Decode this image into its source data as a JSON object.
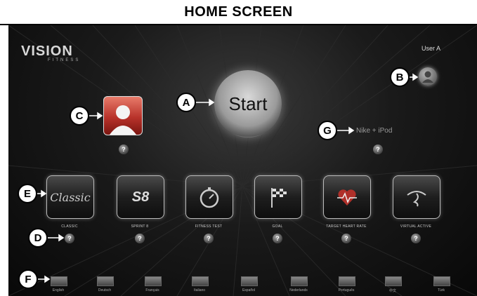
{
  "header": {
    "title": "HOME SCREEN"
  },
  "logo": {
    "main": "VISION",
    "sub": "FITNESS"
  },
  "user": {
    "label": "User A"
  },
  "start": {
    "label": "Start"
  },
  "nike": {
    "label": "Nike + iPod"
  },
  "help": {
    "glyph": "?"
  },
  "programs": [
    {
      "label": "CLASSIC",
      "icon": "classic-script-icon"
    },
    {
      "label": "SPRINT 8",
      "icon": "sprint-8-icon"
    },
    {
      "label": "FITNESS TEST",
      "icon": "stopwatch-icon"
    },
    {
      "label": "GOAL",
      "icon": "checkered-flag-icon"
    },
    {
      "label": "TARGET HEART RATE",
      "icon": "heart-rate-icon"
    },
    {
      "label": "VIRTUAL ACTIVE",
      "icon": "virtual-active-icon"
    }
  ],
  "program_glyphs": {
    "classic": "Classic",
    "sprint": "S8"
  },
  "languages": [
    "English",
    "Deutsch",
    "Français",
    "Italiano",
    "Español",
    "Nederlands",
    "Português",
    "中文",
    "Türk"
  ],
  "callouts": {
    "a": "A",
    "b": "B",
    "c": "C",
    "d": "D",
    "e": "E",
    "f": "F",
    "g": "G"
  },
  "colors": {
    "screen_bg": "#111111",
    "profile_accent": "#c0392b",
    "callout_bg": "#ffffff"
  }
}
